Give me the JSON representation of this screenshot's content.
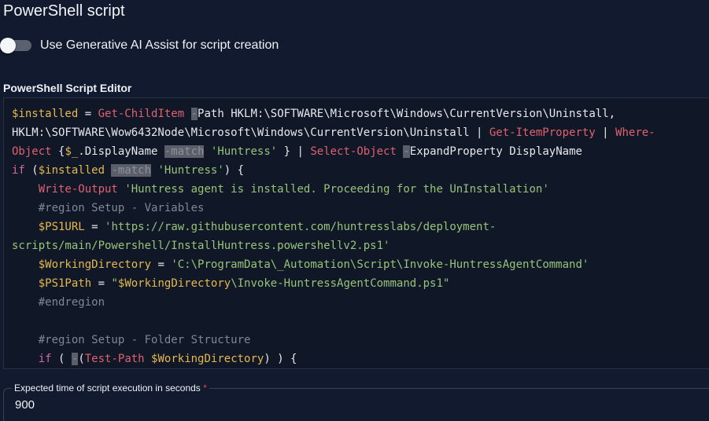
{
  "header": {
    "title": "PowerShell script"
  },
  "ai_assist": {
    "label": "Use Generative AI Assist for script creation",
    "enabled": false
  },
  "editor": {
    "label": "PowerShell Script Editor",
    "lines": [
      [
        {
          "t": "$installed",
          "c": "var"
        },
        {
          "t": " = ",
          "c": "plain"
        },
        {
          "t": "Get-ChildItem",
          "c": "cmd"
        },
        {
          "t": " ",
          "c": "plain"
        },
        {
          "t": "-",
          "c": "hl"
        },
        {
          "t": "Path HKLM:\\SOFTWARE\\Microsoft\\Windows\\CurrentVersion\\Uninstall,",
          "c": "plain"
        }
      ],
      [
        {
          "t": "HKLM:\\SOFTWARE\\Wow6432Node\\Microsoft\\Windows\\CurrentVersion\\Uninstall | ",
          "c": "plain"
        },
        {
          "t": "Get-ItemProperty",
          "c": "cmd"
        },
        {
          "t": " | ",
          "c": "plain"
        },
        {
          "t": "Where-",
          "c": "cmd"
        }
      ],
      [
        {
          "t": "Object",
          "c": "cmd"
        },
        {
          "t": " {",
          "c": "plain"
        },
        {
          "t": "$_",
          "c": "var"
        },
        {
          "t": ".DisplayName ",
          "c": "plain"
        },
        {
          "t": "-match",
          "c": "hl"
        },
        {
          "t": " ",
          "c": "plain"
        },
        {
          "t": "'Huntress'",
          "c": "str"
        },
        {
          "t": " } | ",
          "c": "plain"
        },
        {
          "t": "Select-Object",
          "c": "cmd"
        },
        {
          "t": " ",
          "c": "plain"
        },
        {
          "t": "-",
          "c": "hl"
        },
        {
          "t": "ExpandProperty DisplayName",
          "c": "plain"
        }
      ],
      [
        {
          "t": "if",
          "c": "kw"
        },
        {
          "t": " (",
          "c": "plain"
        },
        {
          "t": "$installed",
          "c": "var"
        },
        {
          "t": " ",
          "c": "plain"
        },
        {
          "t": "-match",
          "c": "hl"
        },
        {
          "t": " ",
          "c": "plain"
        },
        {
          "t": "'Huntress'",
          "c": "str"
        },
        {
          "t": ") {",
          "c": "plain"
        }
      ],
      [
        {
          "t": "    ",
          "c": "plain"
        },
        {
          "t": "Write-Output",
          "c": "cmd"
        },
        {
          "t": " ",
          "c": "plain"
        },
        {
          "t": "'Huntress agent is installed. Proceeding for the UnInstallation'",
          "c": "str"
        }
      ],
      [
        {
          "t": "    ",
          "c": "plain"
        },
        {
          "t": "#region Setup - Variables",
          "c": "cm"
        }
      ],
      [
        {
          "t": "    ",
          "c": "plain"
        },
        {
          "t": "$PS1URL",
          "c": "var"
        },
        {
          "t": " = ",
          "c": "plain"
        },
        {
          "t": "'https://raw.githubusercontent.com/huntresslabs/deployment-",
          "c": "str"
        }
      ],
      [
        {
          "t": "scripts/main/Powershell/InstallHuntress.powershellv2.ps1'",
          "c": "str"
        }
      ],
      [
        {
          "t": "    ",
          "c": "plain"
        },
        {
          "t": "$WorkingDirectory",
          "c": "var"
        },
        {
          "t": " = ",
          "c": "plain"
        },
        {
          "t": "'C:\\ProgramData\\_Automation\\Script\\Invoke-HuntressAgentCommand'",
          "c": "str"
        }
      ],
      [
        {
          "t": "    ",
          "c": "plain"
        },
        {
          "t": "$PS1Path",
          "c": "var"
        },
        {
          "t": " = ",
          "c": "plain"
        },
        {
          "t": "\"",
          "c": "str"
        },
        {
          "t": "$WorkingDirectory",
          "c": "var"
        },
        {
          "t": "\\Invoke-HuntressAgentCommand.ps1\"",
          "c": "str"
        }
      ],
      [
        {
          "t": "    ",
          "c": "plain"
        },
        {
          "t": "#endregion",
          "c": "cm"
        }
      ],
      [
        {
          "t": "",
          "c": "plain"
        }
      ],
      [
        {
          "t": "    ",
          "c": "plain"
        },
        {
          "t": "#region Setup - Folder Structure",
          "c": "cm"
        }
      ],
      [
        {
          "t": "    ",
          "c": "plain"
        },
        {
          "t": "if",
          "c": "kw"
        },
        {
          "t": " ( ",
          "c": "plain"
        },
        {
          "t": "-",
          "c": "hl"
        },
        {
          "t": "(",
          "c": "plain"
        },
        {
          "t": "Test-Path",
          "c": "cmd"
        },
        {
          "t": " ",
          "c": "plain"
        },
        {
          "t": "$WorkingDirectory",
          "c": "var"
        },
        {
          "t": ") ) {",
          "c": "plain"
        }
      ]
    ]
  },
  "execution_time": {
    "label": "Expected time of script execution in seconds",
    "required_mark": "*",
    "value": "900"
  }
}
